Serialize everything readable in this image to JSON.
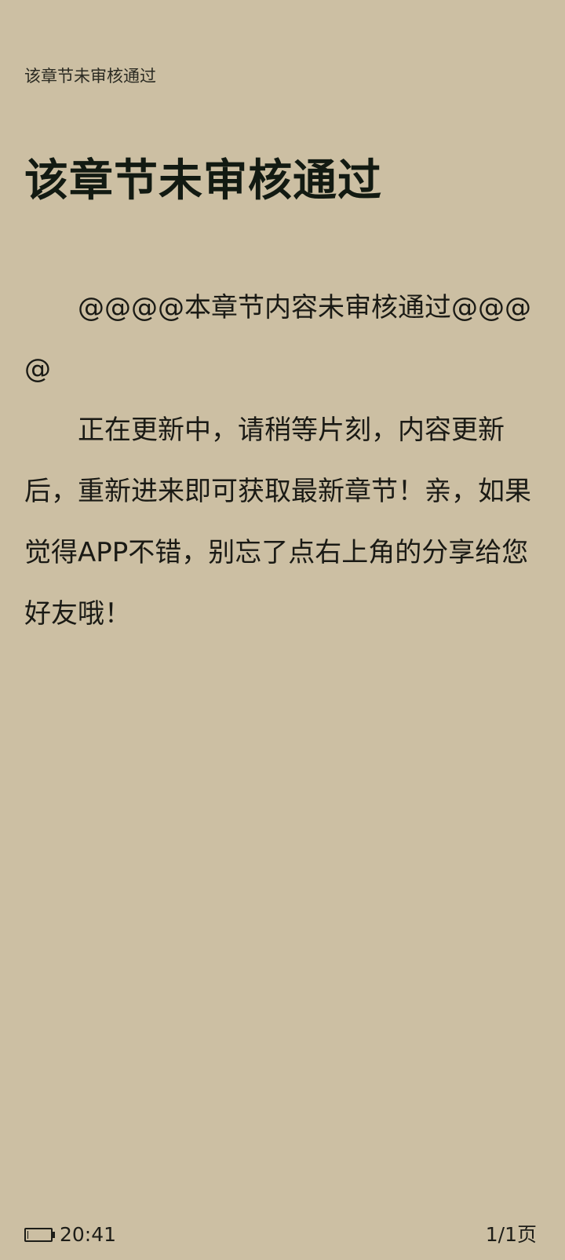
{
  "header": {
    "chapter_name": "该章节未审核通过"
  },
  "chapter": {
    "title": "该章节未审核通过",
    "paragraphs": [
      "@@@@本章节内容未审核通过@@@@",
      "正在更新中，请稍等片刻，内容更新后，重新进来即可获取最新章节！亲，如果觉得APP不错，别忘了点右上角的分享给您好友哦！"
    ]
  },
  "footer": {
    "battery_level": 0.05,
    "time": "20:41",
    "page_indicator": "1/1页"
  }
}
